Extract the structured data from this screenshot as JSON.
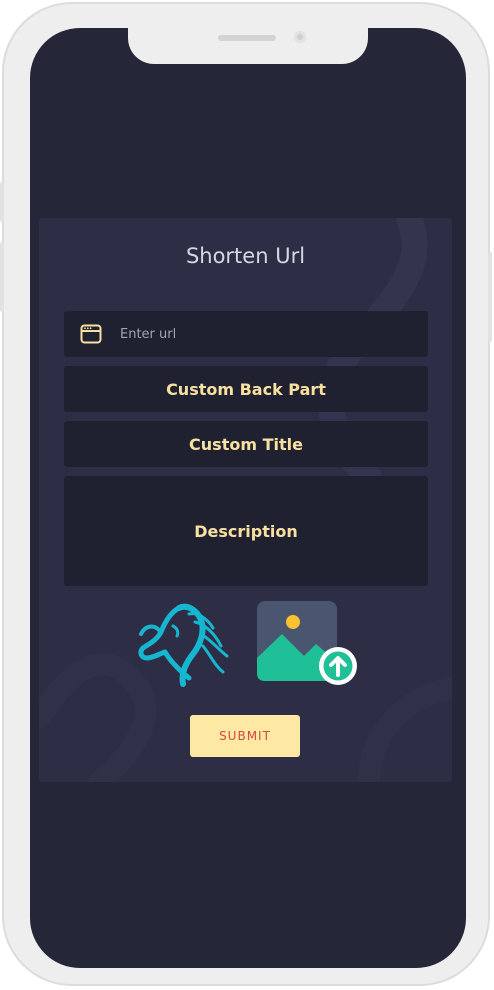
{
  "form": {
    "title": "Shorten Url",
    "url_placeholder": "Enter url",
    "back_part_label": "Custom Back Part",
    "title_label": "Custom Title",
    "description_label": "Description",
    "submit_label": "SUBMIT"
  },
  "icons": {
    "url_icon": "browser-window-icon",
    "logo": "horse-logo-icon",
    "upload": "image-upload-icon"
  },
  "colors": {
    "screen_bg": "#252638",
    "card_bg": "#2d2e46",
    "field_bg": "#1f2030",
    "label_yellow": "#f8e1a0",
    "logo_teal": "#17b6d0",
    "upload_green": "#1fbf97",
    "button_bg": "#fde8a4",
    "button_text": "#d04a40"
  }
}
